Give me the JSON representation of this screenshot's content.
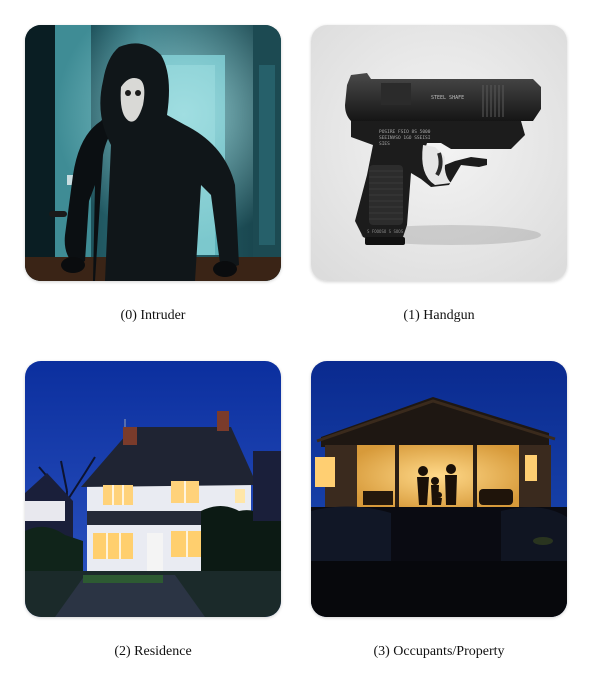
{
  "panels": [
    {
      "index": 0,
      "caption": "(0) Intruder"
    },
    {
      "index": 1,
      "caption": "(1) Handgun"
    },
    {
      "index": 2,
      "caption": "(2) Residence"
    },
    {
      "index": 3,
      "caption": "(3) Occupants/Property"
    }
  ],
  "handgun_engraving": {
    "slide_line": "STEEL SHAFE",
    "frame_line_1": "POSIRE FSIO 8S 5000",
    "frame_line_2": "SEEINVSO 1GO SSEISI",
    "frame_line_3": "SIES",
    "grip_line": "S FOOOSO S SOOS"
  },
  "colors": {
    "caption_text": "#111111",
    "night_sky": "#0b2f9e",
    "window_light": "#ffd27a",
    "hallway_teal": "#2a6f7a"
  }
}
